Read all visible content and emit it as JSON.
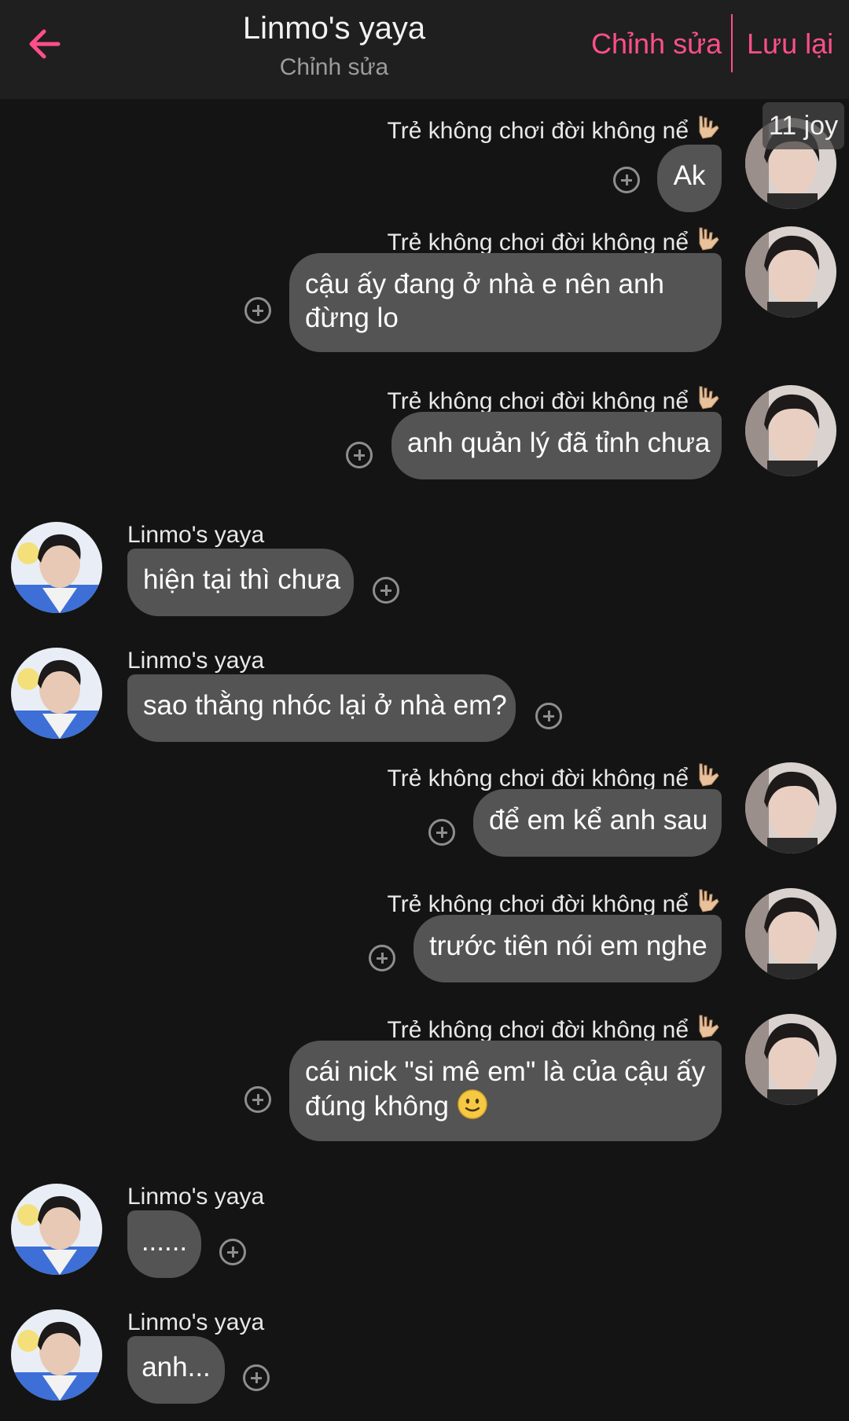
{
  "header": {
    "title": "Linmo's yaya",
    "subtitle": "Chỉnh sửa",
    "edit_label": "Chỉnh sửa",
    "save_label": "Lưu lại",
    "accent_color": "#ff4f8a"
  },
  "overlay_tag": "11 joy",
  "messages": [
    {
      "side": "right",
      "sender": "Trẻ không chơi đời không nể",
      "text": "Ak"
    },
    {
      "side": "right",
      "sender": "Trẻ không chơi đời không nể",
      "text_lines": [
        "cậu ấy đang ở nhà e nên anh",
        "đừng lo"
      ]
    },
    {
      "side": "right",
      "sender": "Trẻ không chơi đời không nể",
      "text": "anh quản lý đã tỉnh chưa"
    },
    {
      "side": "left",
      "sender": "Linmo's yaya",
      "text": "hiện tại thì chưa"
    },
    {
      "side": "left",
      "sender": "Linmo's yaya",
      "text": "sao thằng nhóc lại ở nhà em?"
    },
    {
      "side": "right",
      "sender": "Trẻ không chơi đời không nể",
      "text": "để em kể anh sau"
    },
    {
      "side": "right",
      "sender": "Trẻ không chơi đời không nể",
      "text": "trước tiên nói em nghe"
    },
    {
      "side": "right",
      "sender": "Trẻ không chơi đời không nể",
      "text_lines": [
        "cái nick \"si mê em\" là của cậu ấy",
        "đúng không"
      ],
      "emoji": "slightly-smiling-face-icon"
    },
    {
      "side": "left",
      "sender": "Linmo's yaya",
      "text": "......"
    },
    {
      "side": "left",
      "sender": "Linmo's yaya",
      "text": "anh..."
    }
  ]
}
